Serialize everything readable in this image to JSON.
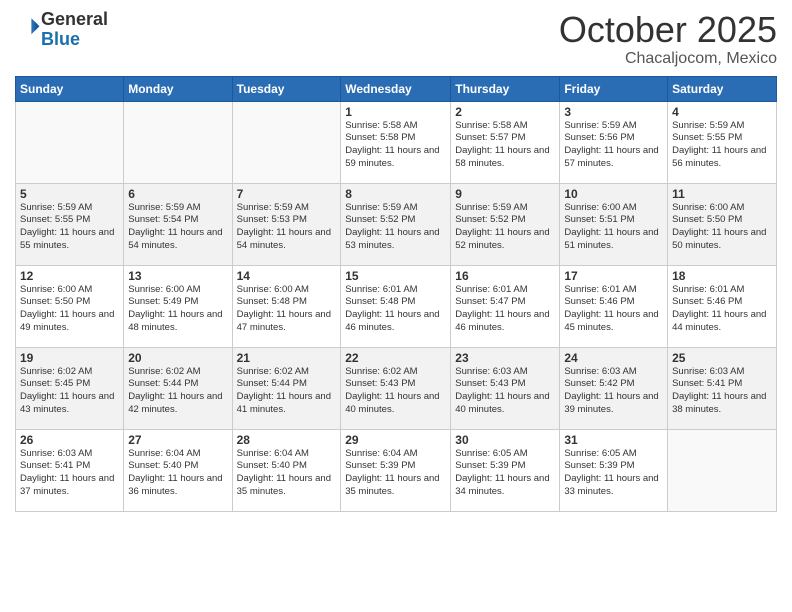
{
  "header": {
    "logo_line1": "General",
    "logo_line2": "Blue",
    "month": "October 2025",
    "location": "Chacaljocom, Mexico"
  },
  "days_of_week": [
    "Sunday",
    "Monday",
    "Tuesday",
    "Wednesday",
    "Thursday",
    "Friday",
    "Saturday"
  ],
  "weeks": [
    [
      {
        "day": "",
        "info": ""
      },
      {
        "day": "",
        "info": ""
      },
      {
        "day": "",
        "info": ""
      },
      {
        "day": "1",
        "info": "Sunrise: 5:58 AM\nSunset: 5:58 PM\nDaylight: 11 hours\nand 59 minutes."
      },
      {
        "day": "2",
        "info": "Sunrise: 5:58 AM\nSunset: 5:57 PM\nDaylight: 11 hours\nand 58 minutes."
      },
      {
        "day": "3",
        "info": "Sunrise: 5:59 AM\nSunset: 5:56 PM\nDaylight: 11 hours\nand 57 minutes."
      },
      {
        "day": "4",
        "info": "Sunrise: 5:59 AM\nSunset: 5:55 PM\nDaylight: 11 hours\nand 56 minutes."
      }
    ],
    [
      {
        "day": "5",
        "info": "Sunrise: 5:59 AM\nSunset: 5:55 PM\nDaylight: 11 hours\nand 55 minutes."
      },
      {
        "day": "6",
        "info": "Sunrise: 5:59 AM\nSunset: 5:54 PM\nDaylight: 11 hours\nand 54 minutes."
      },
      {
        "day": "7",
        "info": "Sunrise: 5:59 AM\nSunset: 5:53 PM\nDaylight: 11 hours\nand 54 minutes."
      },
      {
        "day": "8",
        "info": "Sunrise: 5:59 AM\nSunset: 5:52 PM\nDaylight: 11 hours\nand 53 minutes."
      },
      {
        "day": "9",
        "info": "Sunrise: 5:59 AM\nSunset: 5:52 PM\nDaylight: 11 hours\nand 52 minutes."
      },
      {
        "day": "10",
        "info": "Sunrise: 6:00 AM\nSunset: 5:51 PM\nDaylight: 11 hours\nand 51 minutes."
      },
      {
        "day": "11",
        "info": "Sunrise: 6:00 AM\nSunset: 5:50 PM\nDaylight: 11 hours\nand 50 minutes."
      }
    ],
    [
      {
        "day": "12",
        "info": "Sunrise: 6:00 AM\nSunset: 5:50 PM\nDaylight: 11 hours\nand 49 minutes."
      },
      {
        "day": "13",
        "info": "Sunrise: 6:00 AM\nSunset: 5:49 PM\nDaylight: 11 hours\nand 48 minutes."
      },
      {
        "day": "14",
        "info": "Sunrise: 6:00 AM\nSunset: 5:48 PM\nDaylight: 11 hours\nand 47 minutes."
      },
      {
        "day": "15",
        "info": "Sunrise: 6:01 AM\nSunset: 5:48 PM\nDaylight: 11 hours\nand 46 minutes."
      },
      {
        "day": "16",
        "info": "Sunrise: 6:01 AM\nSunset: 5:47 PM\nDaylight: 11 hours\nand 46 minutes."
      },
      {
        "day": "17",
        "info": "Sunrise: 6:01 AM\nSunset: 5:46 PM\nDaylight: 11 hours\nand 45 minutes."
      },
      {
        "day": "18",
        "info": "Sunrise: 6:01 AM\nSunset: 5:46 PM\nDaylight: 11 hours\nand 44 minutes."
      }
    ],
    [
      {
        "day": "19",
        "info": "Sunrise: 6:02 AM\nSunset: 5:45 PM\nDaylight: 11 hours\nand 43 minutes."
      },
      {
        "day": "20",
        "info": "Sunrise: 6:02 AM\nSunset: 5:44 PM\nDaylight: 11 hours\nand 42 minutes."
      },
      {
        "day": "21",
        "info": "Sunrise: 6:02 AM\nSunset: 5:44 PM\nDaylight: 11 hours\nand 41 minutes."
      },
      {
        "day": "22",
        "info": "Sunrise: 6:02 AM\nSunset: 5:43 PM\nDaylight: 11 hours\nand 40 minutes."
      },
      {
        "day": "23",
        "info": "Sunrise: 6:03 AM\nSunset: 5:43 PM\nDaylight: 11 hours\nand 40 minutes."
      },
      {
        "day": "24",
        "info": "Sunrise: 6:03 AM\nSunset: 5:42 PM\nDaylight: 11 hours\nand 39 minutes."
      },
      {
        "day": "25",
        "info": "Sunrise: 6:03 AM\nSunset: 5:41 PM\nDaylight: 11 hours\nand 38 minutes."
      }
    ],
    [
      {
        "day": "26",
        "info": "Sunrise: 6:03 AM\nSunset: 5:41 PM\nDaylight: 11 hours\nand 37 minutes."
      },
      {
        "day": "27",
        "info": "Sunrise: 6:04 AM\nSunset: 5:40 PM\nDaylight: 11 hours\nand 36 minutes."
      },
      {
        "day": "28",
        "info": "Sunrise: 6:04 AM\nSunset: 5:40 PM\nDaylight: 11 hours\nand 35 minutes."
      },
      {
        "day": "29",
        "info": "Sunrise: 6:04 AM\nSunset: 5:39 PM\nDaylight: 11 hours\nand 35 minutes."
      },
      {
        "day": "30",
        "info": "Sunrise: 6:05 AM\nSunset: 5:39 PM\nDaylight: 11 hours\nand 34 minutes."
      },
      {
        "day": "31",
        "info": "Sunrise: 6:05 AM\nSunset: 5:39 PM\nDaylight: 11 hours\nand 33 minutes."
      },
      {
        "day": "",
        "info": ""
      }
    ]
  ]
}
